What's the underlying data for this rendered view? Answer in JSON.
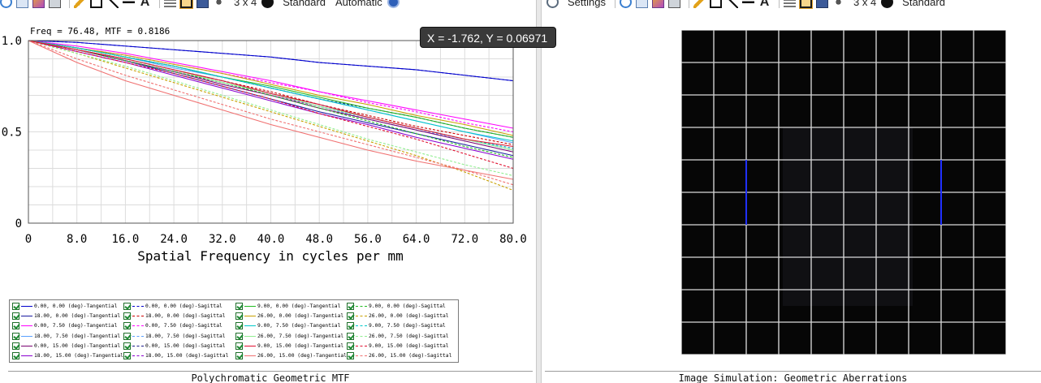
{
  "toolbar": {
    "settings_label": "Settings",
    "layout_label": "3 x 4",
    "style_label": "Standard",
    "scale_label": "Automatic"
  },
  "colors": {
    "grid": "#dcdcdc",
    "tooltip_bg": "#3a3a3a"
  },
  "mtf_header": "Freq = 76.48, MTF = 0.8186",
  "tooltip": "X = -1.762, Y = 0.06971",
  "left_panel_title": "Polychromatic Geometric MTF",
  "right_panel_title": "Image Simulation: Geometric Aberrations",
  "chart_data": {
    "type": "line",
    "xlabel": "Spatial Frequency in cycles per mm",
    "ylabel": "",
    "xlim": [
      0,
      80
    ],
    "ylim": [
      0,
      1
    ],
    "x_ticks": [
      "0",
      "8.0",
      "16.0",
      "24.0",
      "32.0",
      "40.0",
      "48.0",
      "56.0",
      "64.0",
      "72.0",
      "80.0"
    ],
    "y_ticks": [
      "0",
      "0.5",
      "1.0"
    ],
    "grid": true,
    "legend_position": "bottom-left",
    "x": [
      0,
      8,
      16,
      24,
      32,
      40,
      48,
      56,
      64,
      72,
      80
    ],
    "series": [
      {
        "name": "0.00, 0.00 (deg)-Tangential",
        "color": "#0000cc",
        "dash": false,
        "values": [
          1.0,
          0.99,
          0.97,
          0.95,
          0.93,
          0.91,
          0.88,
          0.86,
          0.84,
          0.81,
          0.78
        ]
      },
      {
        "name": "0.00, 0.00 (deg)-Sagittal",
        "color": "#0000cc",
        "dash": true,
        "values": [
          1.0,
          0.99,
          0.97,
          0.95,
          0.93,
          0.91,
          0.88,
          0.86,
          0.84,
          0.81,
          0.78
        ]
      },
      {
        "name": "18.00, 0.00 (deg)-Tangential",
        "color": "#1a1aa0",
        "dash": false,
        "values": [
          1.0,
          0.95,
          0.89,
          0.82,
          0.75,
          0.68,
          0.61,
          0.55,
          0.49,
          0.43,
          0.37
        ]
      },
      {
        "name": "18.00, 0.00 (deg)-Sagittal",
        "color": "#cc0000",
        "dash": true,
        "values": [
          1.0,
          0.95,
          0.9,
          0.84,
          0.78,
          0.72,
          0.65,
          0.59,
          0.53,
          0.48,
          0.43
        ]
      },
      {
        "name": "0.00, 7.50 (deg)-Tangential",
        "color": "#ff00ff",
        "dash": false,
        "values": [
          1.0,
          0.97,
          0.93,
          0.88,
          0.83,
          0.78,
          0.72,
          0.67,
          0.62,
          0.57,
          0.52
        ]
      },
      {
        "name": "0.00, 7.50 (deg)-Sagittal",
        "color": "#ff00ff",
        "dash": true,
        "values": [
          1.0,
          0.96,
          0.92,
          0.87,
          0.82,
          0.77,
          0.72,
          0.66,
          0.61,
          0.55,
          0.5
        ]
      },
      {
        "name": "18.00, 7.50 (deg)-Tangential",
        "color": "#5aa0ff",
        "dash": false,
        "values": [
          1.0,
          0.96,
          0.91,
          0.85,
          0.8,
          0.74,
          0.68,
          0.62,
          0.56,
          0.5,
          0.44
        ]
      },
      {
        "name": "18.00, 7.50 (deg)-Sagittal",
        "color": "#5aa0ff",
        "dash": true,
        "values": [
          1.0,
          0.95,
          0.89,
          0.83,
          0.77,
          0.7,
          0.64,
          0.57,
          0.51,
          0.46,
          0.4
        ]
      },
      {
        "name": "0.00, 15.00 (deg)-Tangential",
        "color": "#7a0070",
        "dash": false,
        "values": [
          1.0,
          0.95,
          0.89,
          0.83,
          0.76,
          0.7,
          0.63,
          0.57,
          0.51,
          0.45,
          0.39
        ]
      },
      {
        "name": "0.00, 15.00 (deg)-Sagittal",
        "color": "#1a1a8a",
        "dash": true,
        "values": [
          1.0,
          0.96,
          0.91,
          0.86,
          0.8,
          0.74,
          0.68,
          0.63,
          0.58,
          0.52,
          0.47
        ]
      },
      {
        "name": "18.00, 15.00 (deg)-Tangential",
        "color": "#8a00d0",
        "dash": false,
        "values": [
          1.0,
          0.94,
          0.88,
          0.81,
          0.74,
          0.67,
          0.6,
          0.54,
          0.47,
          0.41,
          0.35
        ]
      },
      {
        "name": "18.00, 15.00 (deg)-Sagittal",
        "color": "#8a00d0",
        "dash": true,
        "values": [
          1.0,
          0.95,
          0.89,
          0.83,
          0.77,
          0.7,
          0.64,
          0.58,
          0.52,
          0.46,
          0.41
        ]
      },
      {
        "name": "9.00, 0.00 (deg)-Tangential",
        "color": "#22bb22",
        "dash": false,
        "values": [
          1.0,
          0.96,
          0.91,
          0.86,
          0.8,
          0.75,
          0.69,
          0.63,
          0.58,
          0.52,
          0.47
        ]
      },
      {
        "name": "9.00, 0.00 (deg)-Sagittal",
        "color": "#22bb22",
        "dash": true,
        "values": [
          1.0,
          0.95,
          0.89,
          0.83,
          0.77,
          0.7,
          0.63,
          0.56,
          0.49,
          0.42,
          0.36
        ]
      },
      {
        "name": "26.00, 0.00 (deg)-Tangential",
        "color": "#c8a000",
        "dash": false,
        "values": [
          1.0,
          0.96,
          0.92,
          0.87,
          0.82,
          0.76,
          0.7,
          0.65,
          0.59,
          0.54,
          0.48
        ]
      },
      {
        "name": "26.00, 0.00 (deg)-Sagittal",
        "color": "#c8a000",
        "dash": true,
        "values": [
          1.0,
          0.93,
          0.85,
          0.77,
          0.69,
          0.61,
          0.53,
          0.45,
          0.37,
          0.28,
          0.18
        ]
      },
      {
        "name": "9.00, 7.50 (deg)-Tangential",
        "color": "#00c8c8",
        "dash": false,
        "values": [
          1.0,
          0.96,
          0.91,
          0.86,
          0.8,
          0.74,
          0.68,
          0.62,
          0.56,
          0.5,
          0.45
        ]
      },
      {
        "name": "9.00, 7.50 (deg)-Sagittal",
        "color": "#00c8c8",
        "dash": true,
        "values": [
          1.0,
          0.95,
          0.9,
          0.84,
          0.78,
          0.71,
          0.65,
          0.58,
          0.52,
          0.46,
          0.41
        ]
      },
      {
        "name": "26.00, 7.50 (deg)-Tangential",
        "color": "#90ee90",
        "dash": false,
        "values": [
          1.0,
          0.95,
          0.9,
          0.84,
          0.77,
          0.71,
          0.64,
          0.58,
          0.52,
          0.46,
          0.4
        ]
      },
      {
        "name": "26.00, 7.50 (deg)-Sagittal",
        "color": "#90ee90",
        "dash": true,
        "values": [
          1.0,
          0.93,
          0.86,
          0.78,
          0.7,
          0.62,
          0.54,
          0.46,
          0.39,
          0.32,
          0.26
        ]
      },
      {
        "name": "9.00, 15.00 (deg)-Tangential",
        "color": "#e01030",
        "dash": false,
        "values": [
          1.0,
          0.95,
          0.9,
          0.84,
          0.78,
          0.71,
          0.65,
          0.58,
          0.52,
          0.46,
          0.42
        ]
      },
      {
        "name": "9.00, 15.00 (deg)-Sagittal",
        "color": "#e01030",
        "dash": true,
        "values": [
          1.0,
          0.94,
          0.88,
          0.82,
          0.75,
          0.68,
          0.6,
          0.53,
          0.46,
          0.38,
          0.3
        ]
      },
      {
        "name": "26.00, 15.00 (deg)-Tangential",
        "color": "#f07070",
        "dash": false,
        "values": [
          1.0,
          0.88,
          0.78,
          0.7,
          0.62,
          0.54,
          0.47,
          0.4,
          0.34,
          0.29,
          0.24
        ]
      },
      {
        "name": "26.00, 15.00 (deg)-Sagittal",
        "color": "#f07070",
        "dash": true,
        "values": [
          1.0,
          0.9,
          0.81,
          0.73,
          0.65,
          0.57,
          0.5,
          0.43,
          0.36,
          0.29,
          0.21
        ]
      }
    ]
  }
}
